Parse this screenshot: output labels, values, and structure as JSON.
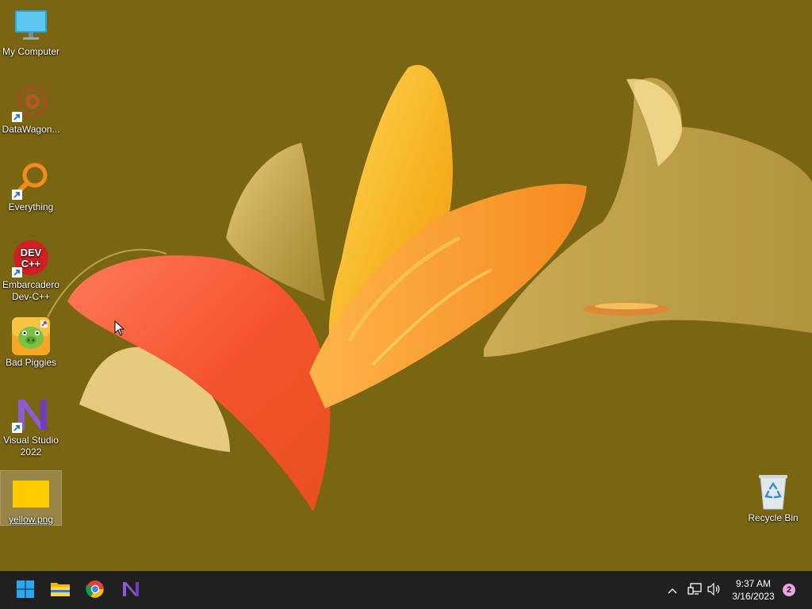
{
  "desktop": {
    "background_color": "#7a6512",
    "icons": [
      {
        "label": "My Computer",
        "icon": "monitor-icon"
      },
      {
        "label": "DataWagon...",
        "icon": "datawagon-icon"
      },
      {
        "label": "Everything",
        "icon": "everything-search-icon"
      },
      {
        "label": "Embarcadero Dev-C++",
        "icon": "dev-cpp-icon",
        "badge_text": "DEV\nC++"
      },
      {
        "label": "Bad Piggies",
        "icon": "bad-piggies-icon"
      },
      {
        "label": "Visual Studio 2022",
        "icon": "visual-studio-icon"
      },
      {
        "label": "yellow.png",
        "icon": "image-file-icon",
        "selected": true
      }
    ],
    "recycle_bin": {
      "label": "Recycle Bin",
      "icon": "recycle-bin-icon"
    }
  },
  "taskbar": {
    "background_color": "#202020",
    "pinned": [
      {
        "name": "Start",
        "icon": "windows-start-icon"
      },
      {
        "name": "File Explorer",
        "icon": "folder-icon"
      },
      {
        "name": "Google Chrome",
        "icon": "chrome-icon"
      },
      {
        "name": "Visual Studio 2022",
        "icon": "visual-studio-icon"
      }
    ],
    "tray": {
      "icons": [
        "chevron-up-icon",
        "network-icon",
        "speaker-icon"
      ],
      "time": "9:37 AM",
      "date": "3/16/2023",
      "notification_count": "2"
    }
  }
}
